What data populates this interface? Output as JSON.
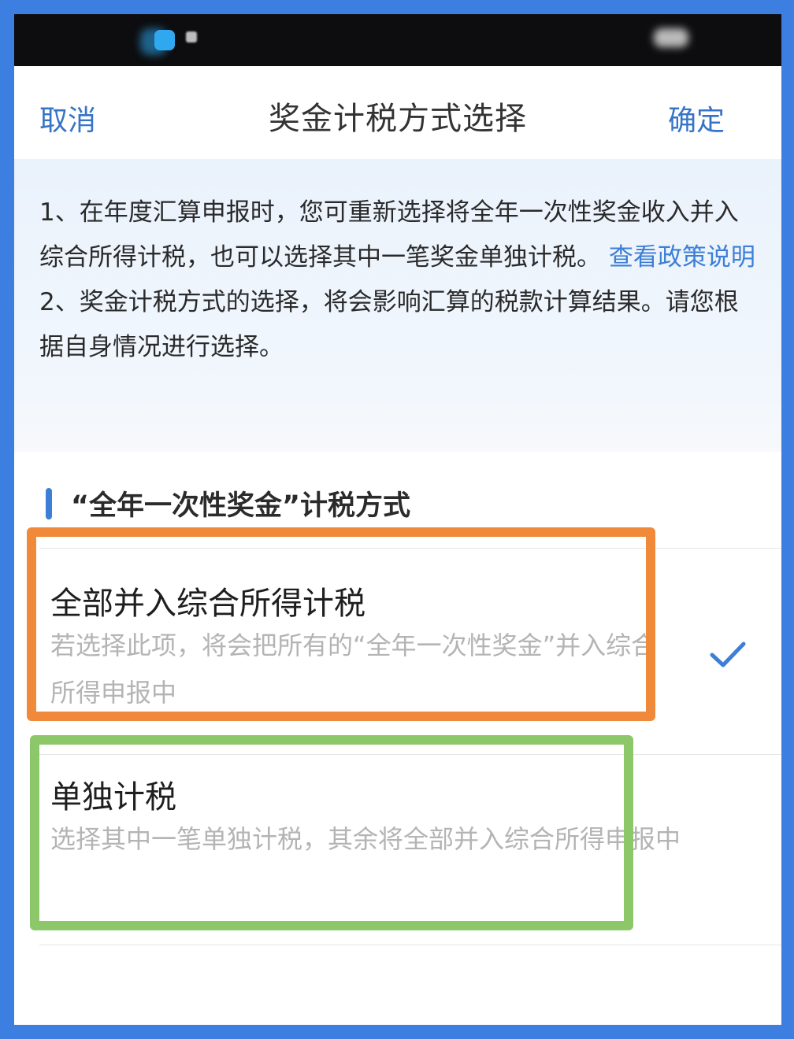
{
  "navbar": {
    "cancel_label": "取消",
    "title": "奖金计税方式选择",
    "confirm_label": "确定"
  },
  "notice": {
    "line1": "1、在年度汇算申报时，您可重新选择将全年一次性奖金收入并入综合所得计税，也可以选择其中一笔奖金单独计税。",
    "policy_link": "查看政策说明",
    "line2": "2、奖金计税方式的选择，将会影响汇算的税款计算结果。请您根据自身情况进行选择。"
  },
  "section": {
    "title": "“全年一次性奖金”计税方式"
  },
  "options": [
    {
      "title": "全部并入综合所得计税",
      "desc": "若选择此项，将会把所有的“全年一次性奖金”并入综合所得申报中",
      "selected": true
    },
    {
      "title": "单独计税",
      "desc": "选择其中一笔单独计税，其余将全部并入综合所得申报中",
      "selected": false
    }
  ],
  "colors": {
    "accent": "#3d7fd6",
    "highlight_selected": "#f08a3a",
    "highlight_other": "#8cc86a",
    "frame": "#3d7fe0"
  }
}
